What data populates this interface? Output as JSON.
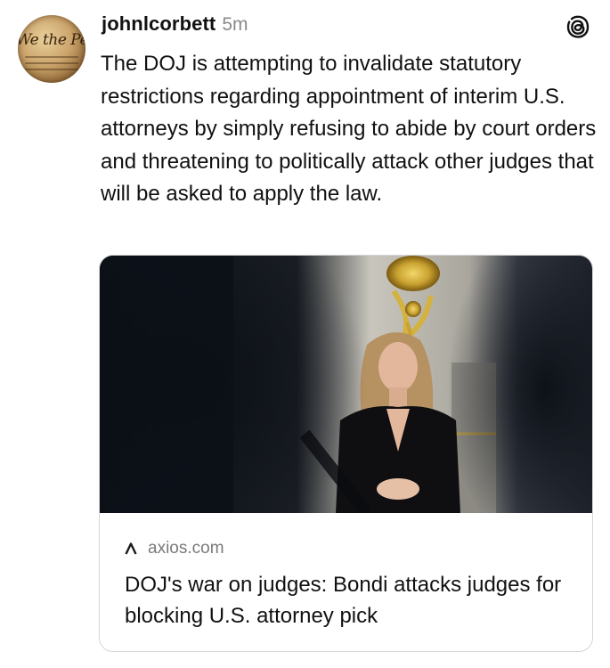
{
  "post": {
    "username": "johnlcorbett",
    "time": "5m",
    "avatar_text": "We the People",
    "text": "The DOJ is attempting to invalidate statutory restrictions regarding appointment of interim U.S. attorneys by simply refusing to abide by court orders and threatening to politically attack other judges that will be asked to apply the law."
  },
  "link_card": {
    "domain": "axios.com",
    "title": "DOJ's war on judges: Bondi attacks judges for blocking U.S. attorney pick",
    "image_alt": "Woman in black blazer seated in ornate room"
  },
  "icons": {
    "app": "threads-logo-icon",
    "source": "axios-logo-icon"
  },
  "colors": {
    "text": "#111111",
    "muted": "#8a8a8a",
    "card_border": "#d6d6d6"
  }
}
